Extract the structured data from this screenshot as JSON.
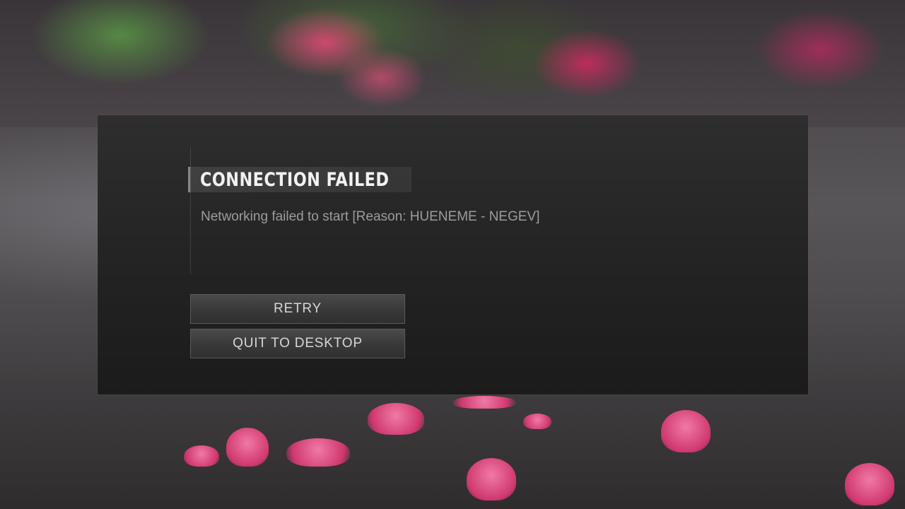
{
  "dialog": {
    "title": "CONNECTION FAILED",
    "message": "Networking failed to start [Reason: HUENEME - NEGEV]",
    "buttons": {
      "retry": "RETRY",
      "quit": "QUIT TO DESKTOP"
    }
  },
  "colors": {
    "dialog_background": "#232323",
    "title_text": "#f2f2f2",
    "message_text": "#9c9c9c",
    "button_background": "#3a3a3a",
    "button_text": "#d6d6d6",
    "petal_accent": "#e0407a"
  }
}
